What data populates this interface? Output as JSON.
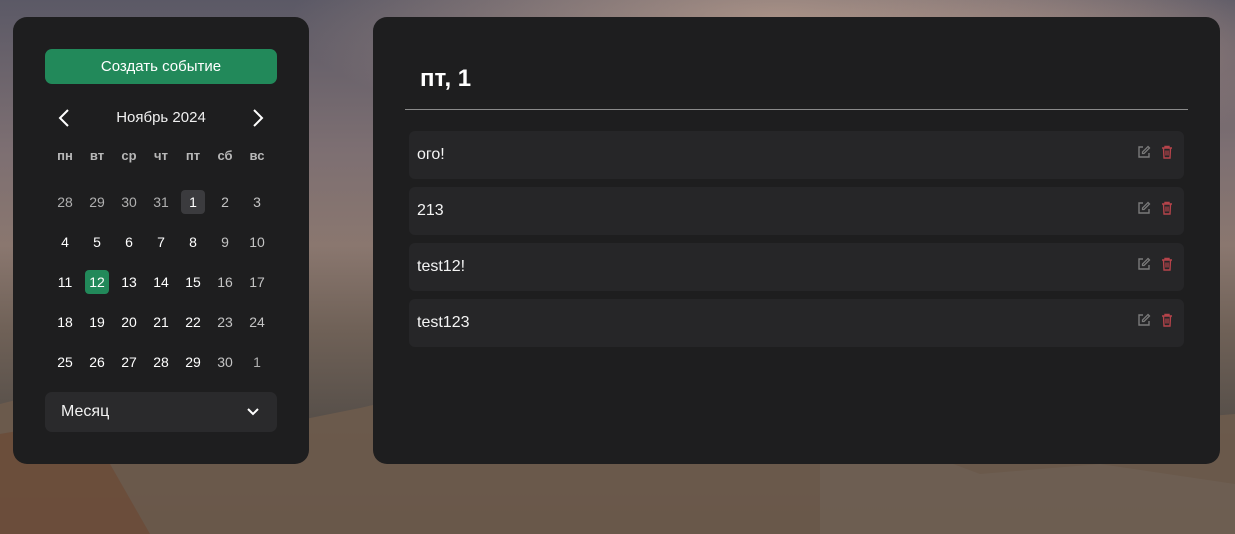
{
  "sidebar": {
    "create_button_label": "Создать событие",
    "month_label": "Ноябрь 2024",
    "weekdays": [
      "пн",
      "вт",
      "ср",
      "чт",
      "пт",
      "сб",
      "вс"
    ],
    "weeks": [
      [
        "28",
        "29",
        "30",
        "31",
        "1",
        "2",
        "3"
      ],
      [
        "4",
        "5",
        "6",
        "7",
        "8",
        "9",
        "10"
      ],
      [
        "11",
        "12",
        "13",
        "14",
        "15",
        "16",
        "17"
      ],
      [
        "18",
        "19",
        "20",
        "21",
        "22",
        "23",
        "24"
      ],
      [
        "25",
        "26",
        "27",
        "28",
        "29",
        "30",
        "1"
      ]
    ],
    "view_select_value": "Месяц"
  },
  "main": {
    "day_title": "пт, 1",
    "events": [
      {
        "title": "ого!"
      },
      {
        "title": "213"
      },
      {
        "title": "test12!"
      },
      {
        "title": "test123"
      }
    ]
  },
  "colors": {
    "accent": "#22895a",
    "delete": "#b5434a",
    "card": "#1e1e1f"
  },
  "icons": {
    "prev": "chevron-left-icon",
    "next": "chevron-right-icon",
    "select": "chevron-down-icon",
    "edit": "edit-icon",
    "delete": "trash-icon"
  }
}
